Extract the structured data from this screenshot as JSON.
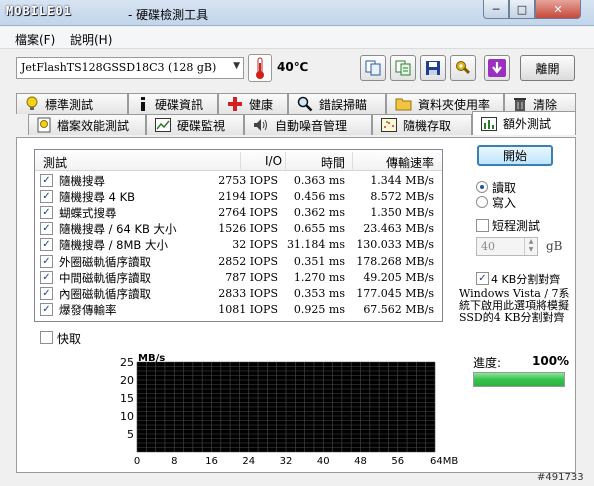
{
  "window": {
    "logo": "MOBILE01",
    "title": "- 硬碟檢測工具",
    "min_glyph": "─",
    "max_glyph": "□",
    "close_glyph": "✕"
  },
  "menu": {
    "file": "檔案(F)",
    "help": "說明(H)"
  },
  "toolbar": {
    "drive": "JetFlashTS128GSSD18C3 (128 gB)",
    "temperature": "40℃",
    "exit_label": "離開"
  },
  "tabs_row1": [
    {
      "label": "標準測試",
      "icon": "lightbulb-icon"
    },
    {
      "label": "硬碟資訊",
      "icon": "info-icon"
    },
    {
      "label": "健康",
      "icon": "health-cross-icon"
    },
    {
      "label": "錯誤掃瞄",
      "icon": "magnifier-icon"
    },
    {
      "label": "資料夾使用率",
      "icon": "folder-icon"
    },
    {
      "label": "清除",
      "icon": "trash-icon"
    }
  ],
  "tabs_row2": [
    {
      "label": "檔案效能測試",
      "icon": "file-lightbulb-icon"
    },
    {
      "label": "硬碟監視",
      "icon": "chart-icon"
    },
    {
      "label": "自動噪音管理",
      "icon": "speaker-icon"
    },
    {
      "label": "隨機存取",
      "icon": "scatter-icon"
    },
    {
      "label": "額外測試",
      "icon": "extra-chart-icon"
    }
  ],
  "table": {
    "headers": {
      "test": "測試",
      "io": "I/O",
      "time": "時間",
      "rate": "傳輸速率"
    },
    "rows": [
      {
        "name": "隨機搜尋",
        "io": "2753 IOPS",
        "time": "0.363 ms",
        "rate": "1.344 MB/s",
        "checked": true
      },
      {
        "name": "隨機搜尋 4 KB",
        "io": "2194 IOPS",
        "time": "0.456 ms",
        "rate": "8.572 MB/s",
        "checked": true
      },
      {
        "name": "蝴蝶式搜尋",
        "io": "2764 IOPS",
        "time": "0.362 ms",
        "rate": "1.350 MB/s",
        "checked": true
      },
      {
        "name": "隨機搜尋 / 64 KB 大小",
        "io": "1526 IOPS",
        "time": "0.655 ms",
        "rate": "23.463 MB/s",
        "checked": true
      },
      {
        "name": "隨機搜尋 / 8MB 大小",
        "io": "32 IOPS",
        "time": "31.184 ms",
        "rate": "130.033 MB/s",
        "checked": true
      },
      {
        "name": "外圈磁軌循序讀取",
        "io": "2852 IOPS",
        "time": "0.351 ms",
        "rate": "178.268 MB/s",
        "checked": true
      },
      {
        "name": "中間磁軌循序讀取",
        "io": "787 IOPS",
        "time": "1.270 ms",
        "rate": "49.205 MB/s",
        "checked": true
      },
      {
        "name": "內圈磁軌循序讀取",
        "io": "2833 IOPS",
        "time": "0.353 ms",
        "rate": "177.045 MB/s",
        "checked": true
      },
      {
        "name": "爆發傳輸率",
        "io": "1081 IOPS",
        "time": "0.925 ms",
        "rate": "67.562 MB/s",
        "checked": true
      }
    ]
  },
  "quick": {
    "label": "快取",
    "checked": false
  },
  "controls": {
    "start_label": "開始",
    "read_label": "讀取",
    "write_label": "寫入",
    "mode": "read",
    "short_test_label": "短程測試",
    "short_test_checked": false,
    "size_value": "40",
    "size_unit": "gB",
    "align_label": "4 KB分割對齊",
    "align_checked": true,
    "note": "Windows Vista / 7系統下啟用此選項將模擬SSD的4 KB分割對齊"
  },
  "progress": {
    "label": "進度:",
    "value_text": "100%",
    "fraction": 1.0,
    "color": "#36c24c"
  },
  "chart_data": {
    "type": "line",
    "title": "",
    "ylabel": "MB/s",
    "xlabel": "",
    "x_ticks": [
      "0",
      "8",
      "16",
      "24",
      "32",
      "40",
      "48",
      "56",
      "64MB"
    ],
    "y_ticks": [
      "5",
      "10",
      "15",
      "20",
      "25"
    ],
    "ylim": [
      0,
      25
    ],
    "xlim": [
      0,
      64
    ],
    "grid": true,
    "background": "#000000",
    "grid_color": "#4a4a4a",
    "series": []
  },
  "watermark": "#491733"
}
